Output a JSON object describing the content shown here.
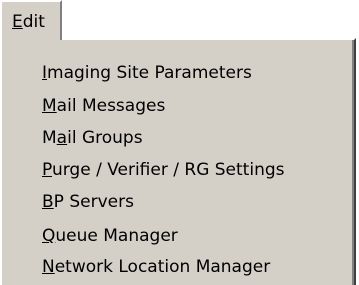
{
  "menubar": {
    "edit": {
      "accel": "E",
      "rest": "dit"
    }
  },
  "menu": {
    "items": [
      {
        "pre": "",
        "accel": "I",
        "post": "maging Site Parameters"
      },
      {
        "pre": "",
        "accel": "M",
        "post": "ail Messages"
      },
      {
        "pre": "M",
        "accel": "a",
        "post": "il Groups"
      },
      {
        "pre": "",
        "accel": "P",
        "post": "urge / Verifier / RG Settings"
      },
      {
        "pre": "",
        "accel": "B",
        "post": "P Servers"
      },
      {
        "pre": "",
        "accel": "Q",
        "post": "ueue Manager"
      },
      {
        "pre": "",
        "accel": "N",
        "post": "etwork Location Manager"
      }
    ]
  },
  "colors": {
    "menu_face": "#d4d0c8",
    "highlight_edge": "#ffffff",
    "shadow_edge": "#808080"
  }
}
